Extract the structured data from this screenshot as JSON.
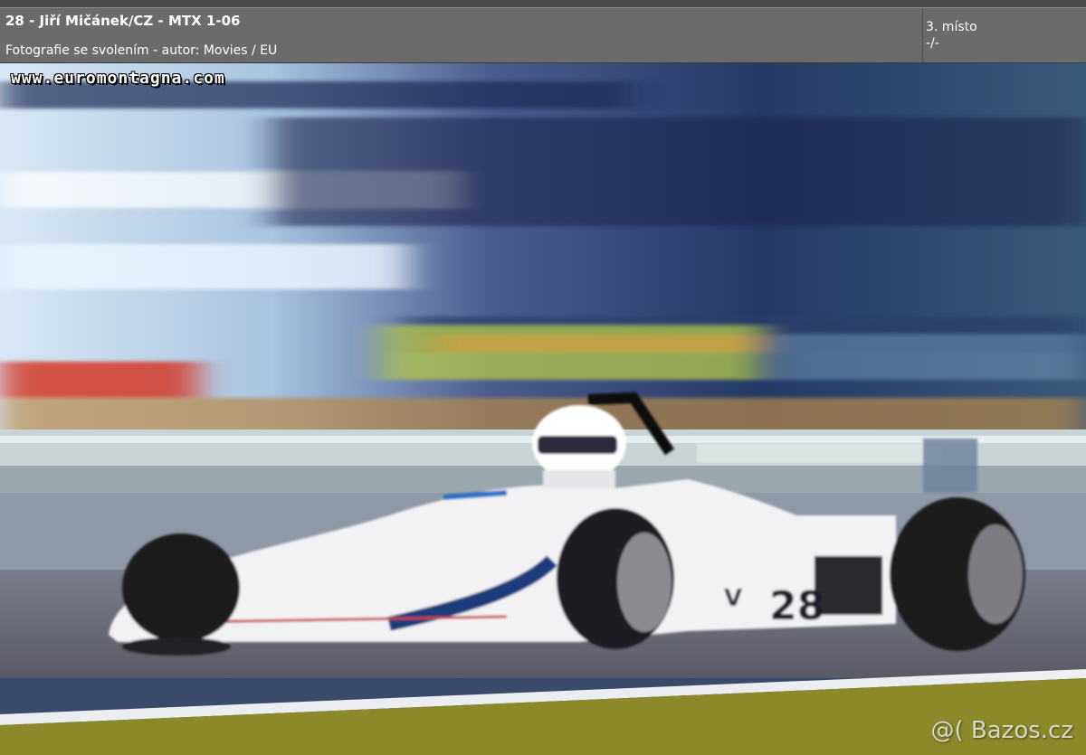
{
  "caption": {
    "title": "28 - Jiří Mičánek/CZ - MTX 1-06",
    "subtitle": "Fotografie se svolením - autor: Movies / EU",
    "place": "3. místo",
    "time": "-/-"
  },
  "photo": {
    "watermark": "www.euromontagna.com",
    "site_mark": "@( Bazos.cz",
    "car_number": "28",
    "colors": {
      "car_body": "#f2f2f4",
      "stripe": "#1f3a7a",
      "helmet": "#ffffff",
      "tarmac": "#6f6f78",
      "grass": "#8a8a2a"
    }
  }
}
